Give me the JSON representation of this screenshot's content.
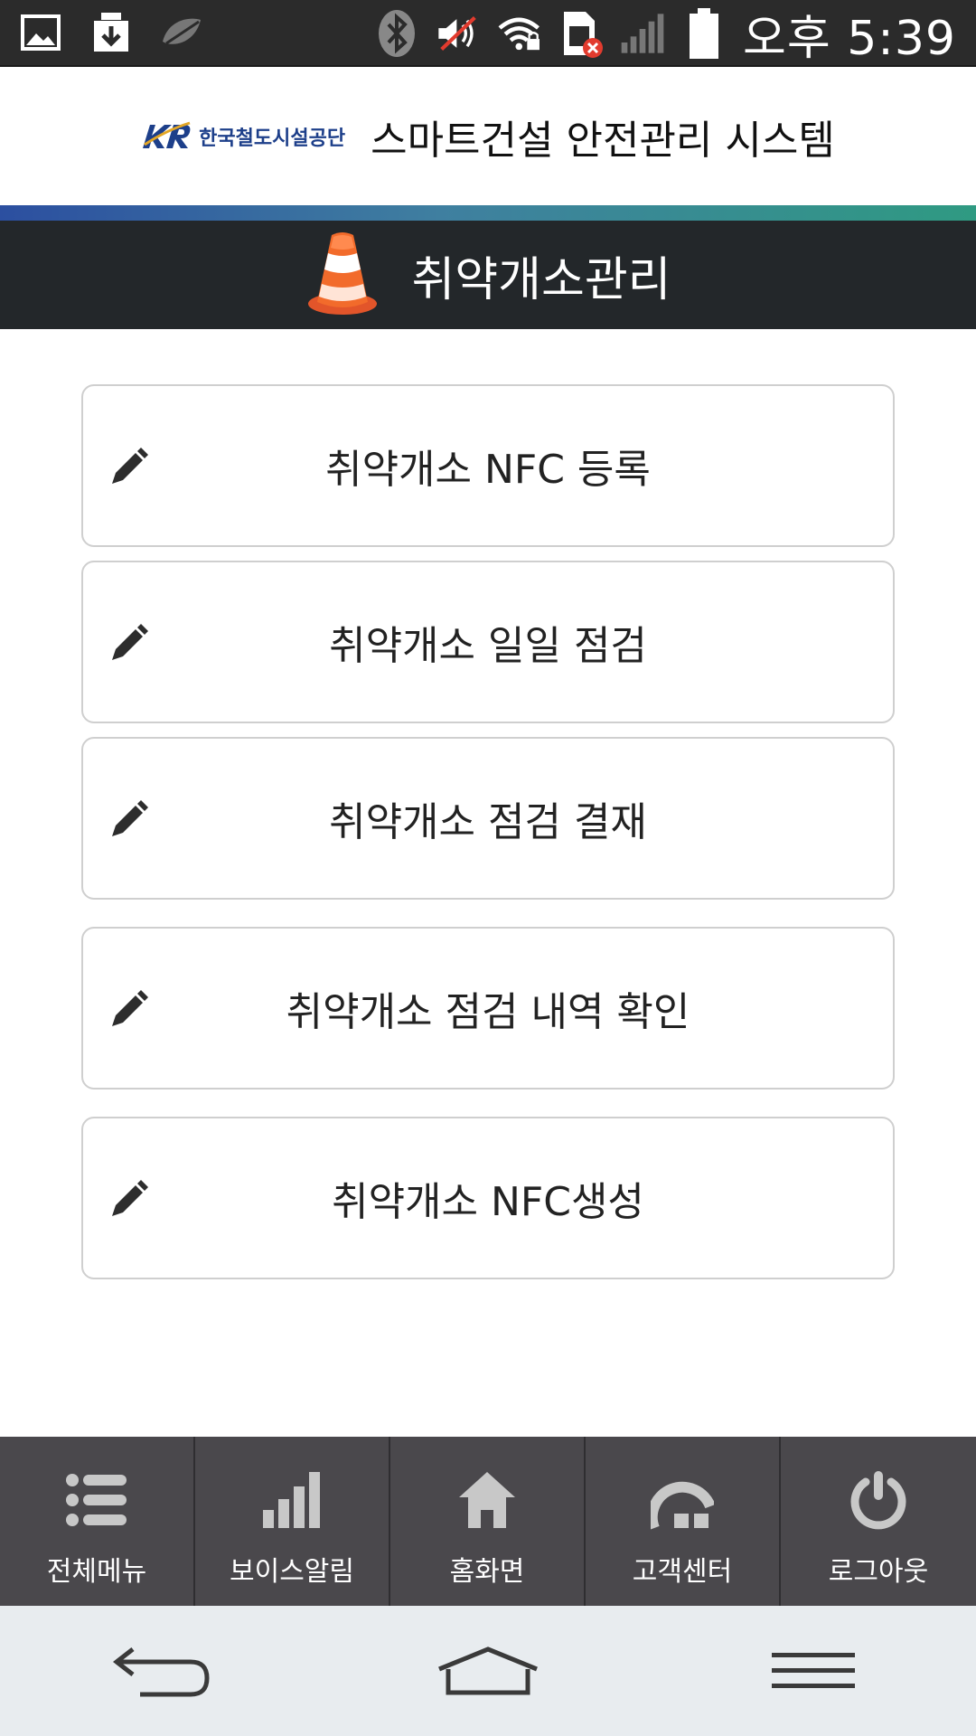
{
  "status_bar": {
    "time": "오후 5:39",
    "icons": [
      "image-icon",
      "download-icon",
      "leaf-icon",
      "bluetooth-icon",
      "mute-icon",
      "wifi-lock-icon",
      "sim-error-icon",
      "signal-icon",
      "battery-icon"
    ]
  },
  "header": {
    "logo_text": "한국철도시설공단",
    "system_title": "스마트건설 안전관리 시스템"
  },
  "section": {
    "title": "취약개소관리",
    "icon": "traffic-cone-icon"
  },
  "menu": {
    "items": [
      {
        "label": "취약개소 NFC 등록"
      },
      {
        "label": "취약개소 일일 점검"
      },
      {
        "label": "취약개소 점검 결재"
      },
      {
        "label": "취약개소 점검 내역 확인"
      },
      {
        "label": "취약개소 NFC생성"
      }
    ]
  },
  "bottom_nav": {
    "items": [
      {
        "label": "전체메뉴",
        "icon": "list-icon"
      },
      {
        "label": "보이스알림",
        "icon": "bar-chart-icon"
      },
      {
        "label": "홈화면",
        "icon": "home-icon"
      },
      {
        "label": "고객센터",
        "icon": "support-icon"
      },
      {
        "label": "로그아웃",
        "icon": "power-icon"
      }
    ]
  },
  "colors": {
    "header_gradient_start": "#2c4fa0",
    "header_gradient_end": "#2f9a82",
    "section_bg": "#23272a",
    "bottom_nav_bg": "#4a484c",
    "cone_orange": "#f26b2b"
  }
}
